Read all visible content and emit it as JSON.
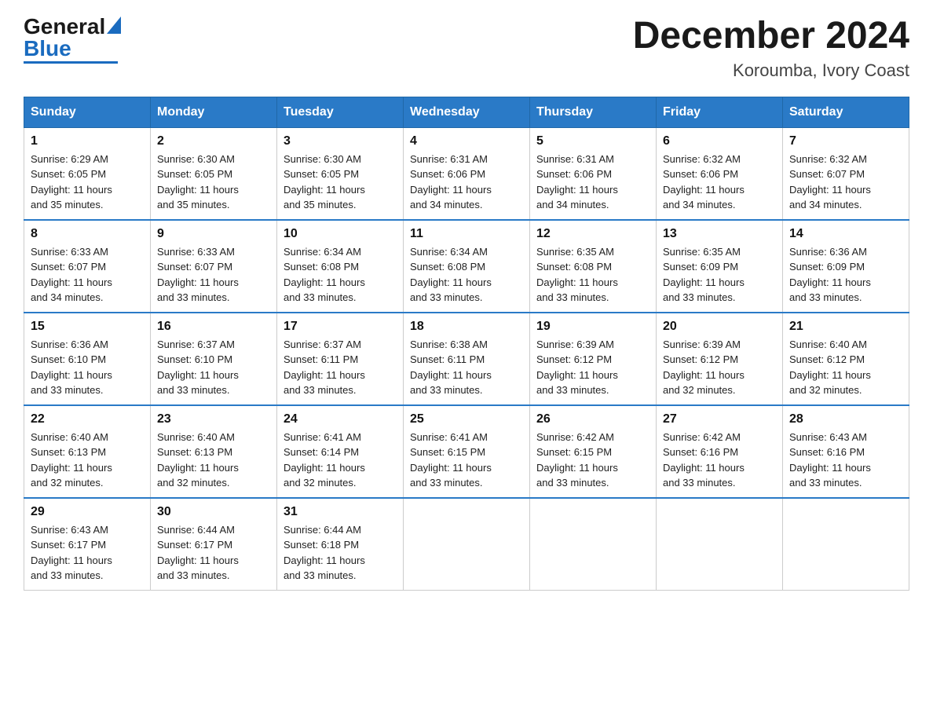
{
  "logo": {
    "general": "General",
    "blue": "Blue"
  },
  "header": {
    "month": "December 2024",
    "location": "Koroumba, Ivory Coast"
  },
  "days_of_week": [
    "Sunday",
    "Monday",
    "Tuesday",
    "Wednesday",
    "Thursday",
    "Friday",
    "Saturday"
  ],
  "weeks": [
    [
      {
        "day": "1",
        "sunrise": "6:29 AM",
        "sunset": "6:05 PM",
        "daylight": "11 hours and 35 minutes."
      },
      {
        "day": "2",
        "sunrise": "6:30 AM",
        "sunset": "6:05 PM",
        "daylight": "11 hours and 35 minutes."
      },
      {
        "day": "3",
        "sunrise": "6:30 AM",
        "sunset": "6:05 PM",
        "daylight": "11 hours and 35 minutes."
      },
      {
        "day": "4",
        "sunrise": "6:31 AM",
        "sunset": "6:06 PM",
        "daylight": "11 hours and 34 minutes."
      },
      {
        "day": "5",
        "sunrise": "6:31 AM",
        "sunset": "6:06 PM",
        "daylight": "11 hours and 34 minutes."
      },
      {
        "day": "6",
        "sunrise": "6:32 AM",
        "sunset": "6:06 PM",
        "daylight": "11 hours and 34 minutes."
      },
      {
        "day": "7",
        "sunrise": "6:32 AM",
        "sunset": "6:07 PM",
        "daylight": "11 hours and 34 minutes."
      }
    ],
    [
      {
        "day": "8",
        "sunrise": "6:33 AM",
        "sunset": "6:07 PM",
        "daylight": "11 hours and 34 minutes."
      },
      {
        "day": "9",
        "sunrise": "6:33 AM",
        "sunset": "6:07 PM",
        "daylight": "11 hours and 33 minutes."
      },
      {
        "day": "10",
        "sunrise": "6:34 AM",
        "sunset": "6:08 PM",
        "daylight": "11 hours and 33 minutes."
      },
      {
        "day": "11",
        "sunrise": "6:34 AM",
        "sunset": "6:08 PM",
        "daylight": "11 hours and 33 minutes."
      },
      {
        "day": "12",
        "sunrise": "6:35 AM",
        "sunset": "6:08 PM",
        "daylight": "11 hours and 33 minutes."
      },
      {
        "day": "13",
        "sunrise": "6:35 AM",
        "sunset": "6:09 PM",
        "daylight": "11 hours and 33 minutes."
      },
      {
        "day": "14",
        "sunrise": "6:36 AM",
        "sunset": "6:09 PM",
        "daylight": "11 hours and 33 minutes."
      }
    ],
    [
      {
        "day": "15",
        "sunrise": "6:36 AM",
        "sunset": "6:10 PM",
        "daylight": "11 hours and 33 minutes."
      },
      {
        "day": "16",
        "sunrise": "6:37 AM",
        "sunset": "6:10 PM",
        "daylight": "11 hours and 33 minutes."
      },
      {
        "day": "17",
        "sunrise": "6:37 AM",
        "sunset": "6:11 PM",
        "daylight": "11 hours and 33 minutes."
      },
      {
        "day": "18",
        "sunrise": "6:38 AM",
        "sunset": "6:11 PM",
        "daylight": "11 hours and 33 minutes."
      },
      {
        "day": "19",
        "sunrise": "6:39 AM",
        "sunset": "6:12 PM",
        "daylight": "11 hours and 33 minutes."
      },
      {
        "day": "20",
        "sunrise": "6:39 AM",
        "sunset": "6:12 PM",
        "daylight": "11 hours and 32 minutes."
      },
      {
        "day": "21",
        "sunrise": "6:40 AM",
        "sunset": "6:12 PM",
        "daylight": "11 hours and 32 minutes."
      }
    ],
    [
      {
        "day": "22",
        "sunrise": "6:40 AM",
        "sunset": "6:13 PM",
        "daylight": "11 hours and 32 minutes."
      },
      {
        "day": "23",
        "sunrise": "6:40 AM",
        "sunset": "6:13 PM",
        "daylight": "11 hours and 32 minutes."
      },
      {
        "day": "24",
        "sunrise": "6:41 AM",
        "sunset": "6:14 PM",
        "daylight": "11 hours and 32 minutes."
      },
      {
        "day": "25",
        "sunrise": "6:41 AM",
        "sunset": "6:15 PM",
        "daylight": "11 hours and 33 minutes."
      },
      {
        "day": "26",
        "sunrise": "6:42 AM",
        "sunset": "6:15 PM",
        "daylight": "11 hours and 33 minutes."
      },
      {
        "day": "27",
        "sunrise": "6:42 AM",
        "sunset": "6:16 PM",
        "daylight": "11 hours and 33 minutes."
      },
      {
        "day": "28",
        "sunrise": "6:43 AM",
        "sunset": "6:16 PM",
        "daylight": "11 hours and 33 minutes."
      }
    ],
    [
      {
        "day": "29",
        "sunrise": "6:43 AM",
        "sunset": "6:17 PM",
        "daylight": "11 hours and 33 minutes."
      },
      {
        "day": "30",
        "sunrise": "6:44 AM",
        "sunset": "6:17 PM",
        "daylight": "11 hours and 33 minutes."
      },
      {
        "day": "31",
        "sunrise": "6:44 AM",
        "sunset": "6:18 PM",
        "daylight": "11 hours and 33 minutes."
      },
      null,
      null,
      null,
      null
    ]
  ],
  "labels": {
    "sunrise": "Sunrise:",
    "sunset": "Sunset:",
    "daylight": "Daylight:"
  }
}
